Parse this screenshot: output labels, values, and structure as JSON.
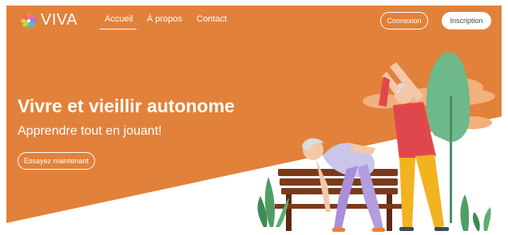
{
  "brand": {
    "name": "VIVA",
    "icon": "flower-icon"
  },
  "nav": {
    "links": [
      {
        "label": "Accueil",
        "active": true
      },
      {
        "label": "À propos",
        "active": false
      },
      {
        "label": "Contact",
        "active": false
      }
    ],
    "login_label": "Connexion",
    "signup_label": "Inscription"
  },
  "hero": {
    "headline": "Vivre et vieillir autonome",
    "subline": "Apprendre tout en jouant!",
    "cta_label": "Essayez maintenant"
  },
  "colors": {
    "accent": "#e2813a",
    "tree": "#6db98a",
    "cloud": "#f2b07c",
    "bench": "#7a3b1c"
  }
}
